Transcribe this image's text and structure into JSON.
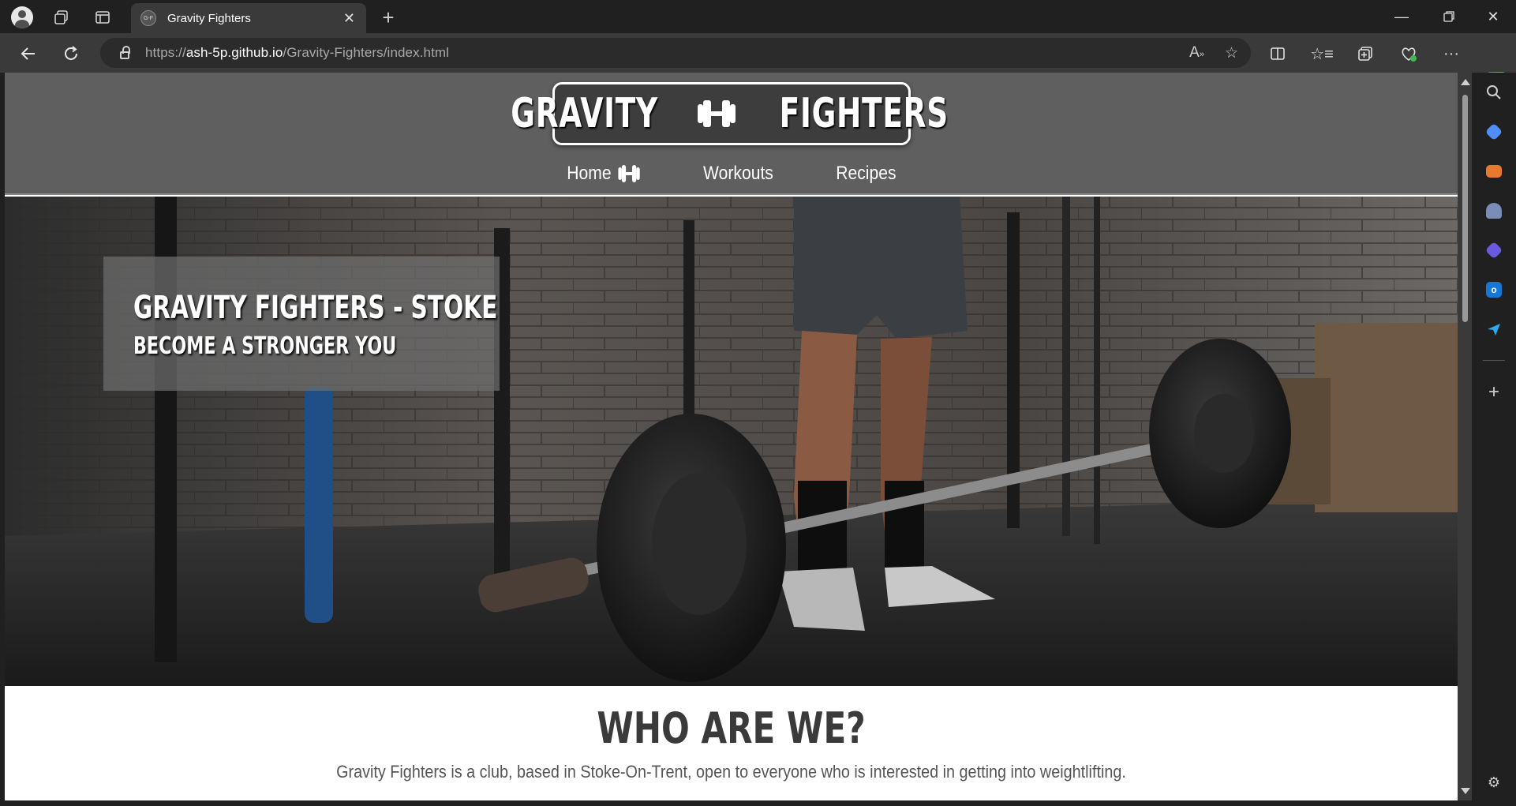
{
  "browser": {
    "tab_title": "Gravity Fighters",
    "tab_favicon_text": "G-F",
    "url_prefix": "https://",
    "url_host": "ash-5p.github.io",
    "url_path": "/Gravity-Fighters/index.html"
  },
  "site": {
    "logo_left": "GRAVITY",
    "logo_right": "FIGHTERS",
    "nav": [
      {
        "label": "Home"
      },
      {
        "label": "Workouts"
      },
      {
        "label": "Recipes"
      }
    ],
    "hero": {
      "title": "GRAVITY FIGHTERS - STOKE",
      "subtitle": "BECOME A STRONGER YOU"
    },
    "about": {
      "title": "WHO ARE WE?",
      "text": "Gravity Fighters is a club, based in Stoke-On-Trent, open to everyone who is interested in getting into weightlifting."
    }
  },
  "colors": {
    "header_bg": "#5f5f5f",
    "browser_dark": "#202020",
    "browser_toolbar": "#3a3a3a"
  }
}
